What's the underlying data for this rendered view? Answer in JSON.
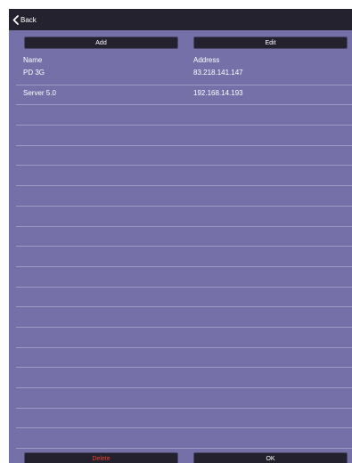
{
  "nav": {
    "back_label": "Back"
  },
  "toolbar": {
    "add_label": "Add",
    "edit_label": "Edit"
  },
  "columns": {
    "name": "Name",
    "address": "Address"
  },
  "rows": [
    {
      "name": "PD 3G",
      "address": "83.218.141.147"
    },
    {
      "name": "Server 5.0",
      "address": "192.168.14.193"
    },
    {
      "name": "",
      "address": ""
    },
    {
      "name": "",
      "address": ""
    },
    {
      "name": "",
      "address": ""
    },
    {
      "name": "",
      "address": ""
    },
    {
      "name": "",
      "address": ""
    },
    {
      "name": "",
      "address": ""
    },
    {
      "name": "",
      "address": ""
    },
    {
      "name": "",
      "address": ""
    },
    {
      "name": "",
      "address": ""
    },
    {
      "name": "",
      "address": ""
    },
    {
      "name": "",
      "address": ""
    },
    {
      "name": "",
      "address": ""
    },
    {
      "name": "",
      "address": ""
    },
    {
      "name": "",
      "address": ""
    },
    {
      "name": "",
      "address": ""
    },
    {
      "name": "",
      "address": ""
    },
    {
      "name": "",
      "address": ""
    }
  ],
  "footer": {
    "delete_label": "Delete",
    "ok_label": "OK"
  },
  "colors": {
    "background": "#7570a8",
    "navbar": "#24222f",
    "button": "#23212d",
    "row_divider": "#9d98c4",
    "delete_text": "#e8402f",
    "text": "#ffffff"
  },
  "icons": {
    "back": "chevron-left-icon"
  }
}
